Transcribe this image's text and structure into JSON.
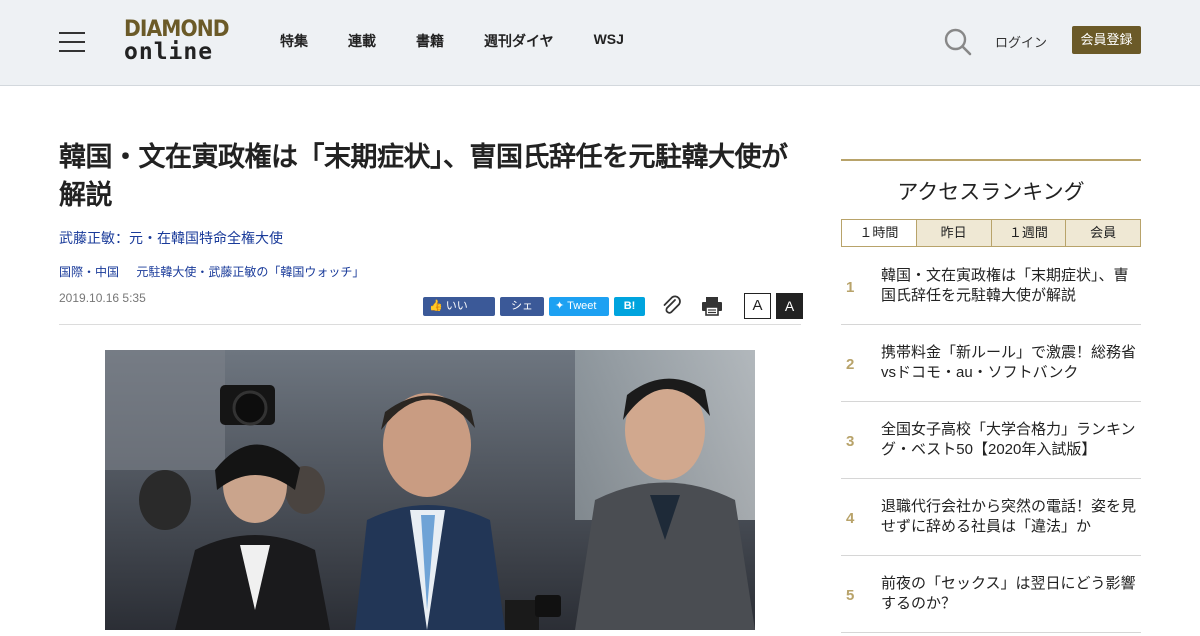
{
  "header": {
    "logo_top": "DIAMOND",
    "logo_bottom": "online",
    "nav": [
      "特集",
      "連載",
      "書籍",
      "週刊ダイヤ",
      "WSJ"
    ],
    "login": "ログイン",
    "register": "会員登録"
  },
  "article": {
    "title": "韓国・文在寅政権は「末期症状」、曺国氏辞任を元駐韓大使が解説",
    "author": "武藤正敏：元・在韓国特命全権大使",
    "tags": [
      "国際・中国",
      "元駐韓大使・武藤正敏の「韓国ウォッチ」"
    ],
    "date": "2019.10.16 5:35",
    "share": {
      "like": "いいね！",
      "share": "シェア",
      "tweet": "Tweet",
      "hatena": "B!",
      "font_small": "A",
      "font_large": "A"
    }
  },
  "ranking": {
    "title": "アクセスランキング",
    "tabs": [
      "１時間",
      "昨日",
      "１週間",
      "会員"
    ],
    "items": [
      {
        "rank": "1",
        "text": "韓国・文在寅政権は「末期症状」、曺国氏辞任を元駐韓大使が解説"
      },
      {
        "rank": "2",
        "text": "携帯料金「新ルール」で激震！総務省vsドコモ・au・ソフトバンク"
      },
      {
        "rank": "3",
        "text": "全国女子高校「大学合格力」ランキング・ベスト50【2020年入試版】"
      },
      {
        "rank": "4",
        "text": "退職代行会社から突然の電話！姿を見せずに辞める社員は「違法」か"
      },
      {
        "rank": "5",
        "text": "前夜の「セックス」は翌日にどう影響するのか？"
      }
    ]
  },
  "colors": {
    "brand_gold": "#6b5a28",
    "accent": "#b8a36a",
    "link_blue": "#1a3b9a"
  }
}
